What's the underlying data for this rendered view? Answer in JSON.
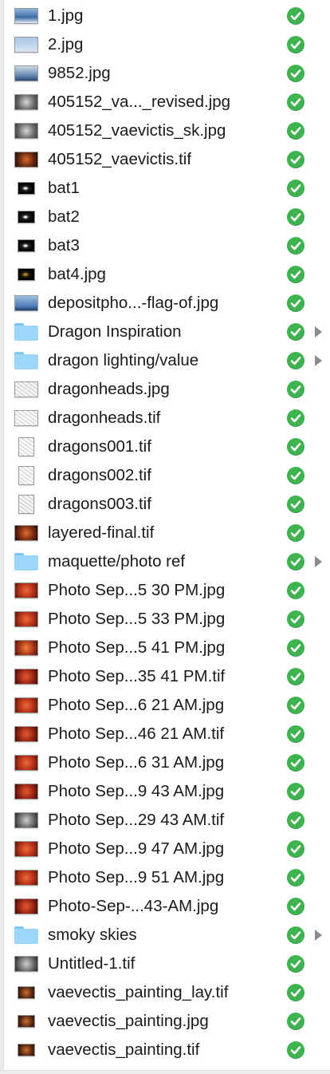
{
  "files": [
    {
      "name": "1.jpg",
      "thumb": "t-sky",
      "shape": "land",
      "kind": "image-file-icon",
      "status": "synced"
    },
    {
      "name": "2.jpg",
      "thumb": "t-sky2",
      "shape": "land",
      "kind": "image-file-icon",
      "status": "synced"
    },
    {
      "name": "9852.jpg",
      "thumb": "t-sky3",
      "shape": "land",
      "kind": "image-file-icon",
      "status": "synced"
    },
    {
      "name": "405152_va..._revised.jpg",
      "thumb": "t-gray",
      "shape": "land",
      "kind": "image-file-icon",
      "status": "synced"
    },
    {
      "name": "405152_vaevictis_sk.jpg",
      "thumb": "t-gray",
      "shape": "land",
      "kind": "image-file-icon",
      "status": "synced"
    },
    {
      "name": "405152_vaevictis.tif",
      "thumb": "t-dragon",
      "shape": "land",
      "kind": "image-file-icon",
      "status": "synced"
    },
    {
      "name": "bat1",
      "thumb": "t-dark",
      "shape": "small",
      "kind": "image-file-icon",
      "status": "synced"
    },
    {
      "name": "bat2",
      "thumb": "t-dark",
      "shape": "small",
      "kind": "image-file-icon",
      "status": "synced"
    },
    {
      "name": "bat3",
      "thumb": "t-dark",
      "shape": "small",
      "kind": "image-file-icon",
      "status": "synced"
    },
    {
      "name": "bat4.jpg",
      "thumb": "t-darkgold",
      "shape": "small",
      "kind": "image-file-icon",
      "status": "synced"
    },
    {
      "name": "depositpho...-flag-of.jpg",
      "thumb": "t-sky4",
      "shape": "land",
      "kind": "image-file-icon",
      "status": "synced"
    },
    {
      "name": "Dragon Inspiration",
      "kind": "folder-icon",
      "status": "synced",
      "expandable": true
    },
    {
      "name": "dragon lighting/value",
      "kind": "folder-icon",
      "status": "synced",
      "expandable": true
    },
    {
      "name": "dragonheads.jpg",
      "thumb": "t-sketch",
      "shape": "land",
      "kind": "image-file-icon",
      "status": "synced"
    },
    {
      "name": "dragonheads.tif",
      "thumb": "t-sketch2",
      "shape": "land",
      "kind": "image-file-icon",
      "status": "synced"
    },
    {
      "name": "dragons001.tif",
      "thumb": "t-sketch2",
      "shape": "port",
      "kind": "image-file-icon",
      "status": "synced"
    },
    {
      "name": "dragons002.tif",
      "thumb": "t-sketch2",
      "shape": "port",
      "kind": "image-file-icon",
      "status": "synced"
    },
    {
      "name": "dragons003.tif",
      "thumb": "t-sketch",
      "shape": "port",
      "kind": "image-file-icon",
      "status": "synced"
    },
    {
      "name": "layered-final.tif",
      "thumb": "t-layered",
      "shape": "land",
      "kind": "image-file-icon",
      "status": "synced"
    },
    {
      "name": "maquette/photo ref",
      "kind": "folder-icon",
      "status": "synced",
      "expandable": true
    },
    {
      "name": "Photo Sep...5 30 PM.jpg",
      "thumb": "t-photo",
      "shape": "land",
      "kind": "image-file-icon",
      "status": "synced"
    },
    {
      "name": "Photo Sep...5 33 PM.jpg",
      "thumb": "t-photo",
      "shape": "land",
      "kind": "image-file-icon",
      "status": "synced"
    },
    {
      "name": "Photo Sep...5 41 PM.jpg",
      "thumb": "t-photo3",
      "shape": "land",
      "kind": "image-file-icon",
      "status": "synced"
    },
    {
      "name": "Photo Sep...35 41 PM.tif",
      "thumb": "t-photo2",
      "shape": "land",
      "kind": "image-file-icon",
      "status": "synced"
    },
    {
      "name": "Photo Sep...6 21 AM.jpg",
      "thumb": "t-photo",
      "shape": "land",
      "kind": "image-file-icon",
      "status": "synced"
    },
    {
      "name": "Photo Sep...46 21 AM.tif",
      "thumb": "t-photo2",
      "shape": "land",
      "kind": "image-file-icon",
      "status": "synced"
    },
    {
      "name": "Photo Sep...6 31 AM.jpg",
      "thumb": "t-photo",
      "shape": "land",
      "kind": "image-file-icon",
      "status": "synced"
    },
    {
      "name": "Photo Sep...9 43 AM.jpg",
      "thumb": "t-photo2",
      "shape": "land",
      "kind": "image-file-icon",
      "status": "synced"
    },
    {
      "name": "Photo Sep...29 43 AM.tif",
      "thumb": "t-mono",
      "shape": "land",
      "kind": "image-file-icon",
      "status": "synced"
    },
    {
      "name": "Photo Sep...9 47 AM.jpg",
      "thumb": "t-photo",
      "shape": "land",
      "kind": "image-file-icon",
      "status": "synced"
    },
    {
      "name": "Photo Sep...9 51 AM.jpg",
      "thumb": "t-photo",
      "shape": "land",
      "kind": "image-file-icon",
      "status": "synced"
    },
    {
      "name": "Photo-Sep-...43-AM.jpg",
      "thumb": "t-photo2",
      "shape": "land",
      "kind": "image-file-icon",
      "status": "synced"
    },
    {
      "name": "smoky skies",
      "kind": "folder-icon",
      "status": "synced",
      "expandable": true
    },
    {
      "name": "Untitled-1.tif",
      "thumb": "t-mono",
      "shape": "land",
      "kind": "image-file-icon",
      "status": "synced"
    },
    {
      "name": "vaevectis_painting_lay.tif",
      "thumb": "t-paint",
      "shape": "small",
      "kind": "image-file-icon",
      "status": "synced"
    },
    {
      "name": "vaevectis_painting.jpg",
      "thumb": "t-paint",
      "shape": "small",
      "kind": "image-file-icon",
      "status": "synced"
    },
    {
      "name": "vaevectis_painting.tif",
      "thumb": "t-paint",
      "shape": "small",
      "kind": "image-file-icon",
      "status": "synced"
    }
  ],
  "colors": {
    "sync_check": "#3eb34f",
    "folder": "#9dd6fb",
    "disclosure_arrow": "#8c8c8c",
    "text": "#1a1a1a"
  }
}
